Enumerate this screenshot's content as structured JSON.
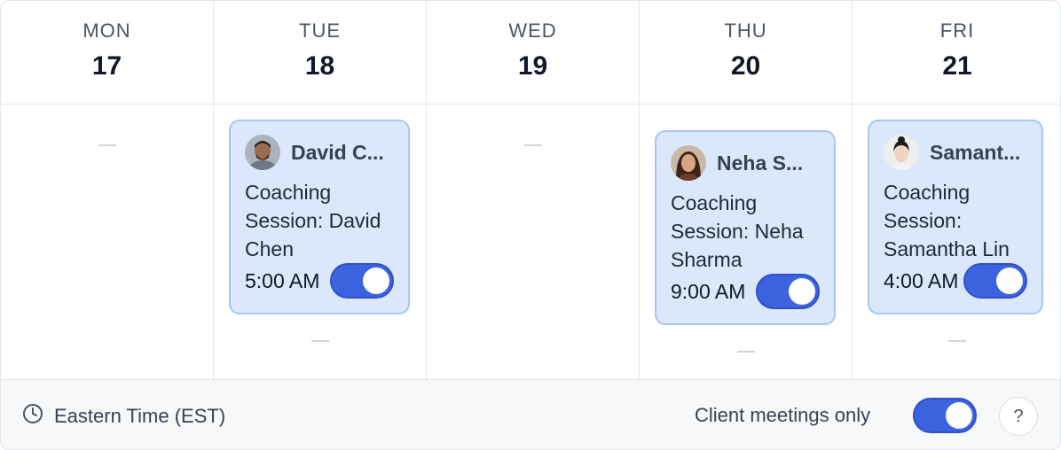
{
  "days": [
    {
      "dow": "MON",
      "date": "17"
    },
    {
      "dow": "TUE",
      "date": "18"
    },
    {
      "dow": "WED",
      "date": "19"
    },
    {
      "dow": "THU",
      "date": "20"
    },
    {
      "dow": "FRI",
      "date": "21"
    }
  ],
  "events": {
    "tue": {
      "name": "David C...",
      "title": "Coaching Session: David Chen",
      "time": "5:00 AM",
      "enabled": true,
      "avatar": "person-avatar-david"
    },
    "thu": {
      "name": "Neha S...",
      "title": "Coaching Session: Neha Sharma",
      "time": "9:00 AM",
      "enabled": true,
      "avatar": "person-avatar-neha"
    },
    "fri": {
      "name": "Samant...",
      "title": "Coaching Session: Samantha Lin",
      "time": "4:00 AM",
      "enabled": true,
      "avatar": "person-avatar-samantha"
    }
  },
  "footer": {
    "timezone": "Eastern Time (EST)",
    "timezone_icon": "clock-icon",
    "client_only_label": "Client meetings only",
    "client_only_enabled": true,
    "help_label": "?"
  },
  "colors": {
    "accent": "#3b63e0",
    "event_bg": "#dbe7fb",
    "event_border": "#a8c6f5"
  }
}
